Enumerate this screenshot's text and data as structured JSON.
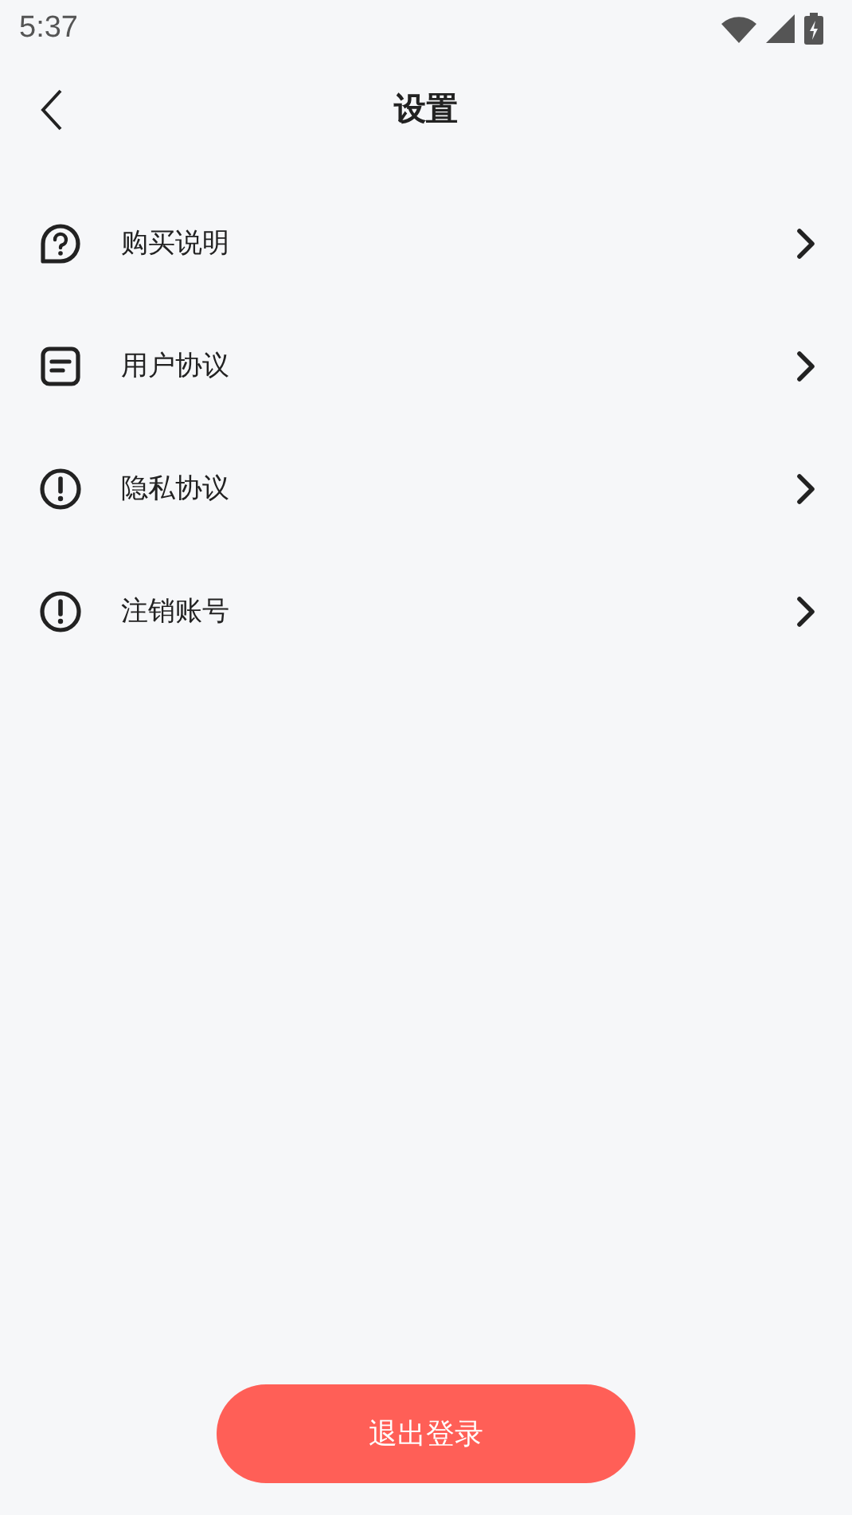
{
  "status_bar": {
    "time": "5:37"
  },
  "nav_bar": {
    "title": "设置"
  },
  "menu_items": [
    {
      "label": "购买说明",
      "kind": "question"
    },
    {
      "label": "用户协议",
      "kind": "document"
    },
    {
      "label": "隐私协议",
      "kind": "alert"
    },
    {
      "label": "注销账号",
      "kind": "alert"
    }
  ],
  "logout_button": {
    "label": "退出登录"
  }
}
